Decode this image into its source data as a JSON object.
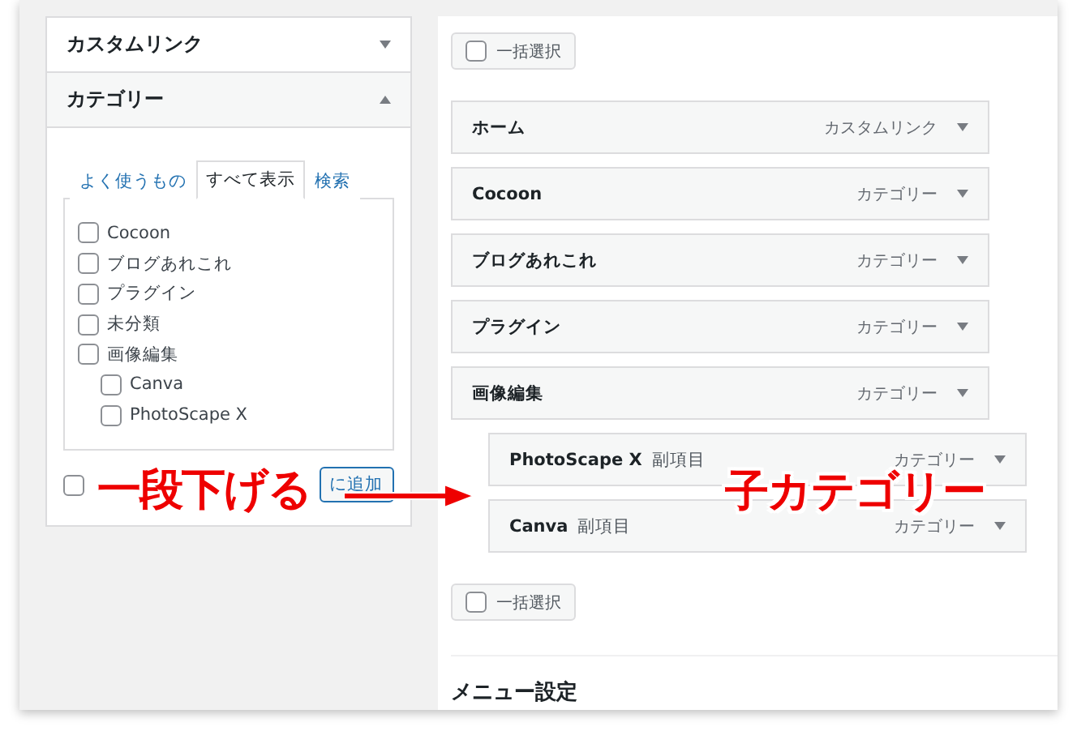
{
  "sidebar": {
    "sections": [
      {
        "title": "カスタムリンク",
        "expanded": false
      },
      {
        "title": "カテゴリー",
        "expanded": true
      }
    ],
    "tabs": [
      {
        "label": "よく使うもの",
        "selected": false
      },
      {
        "label": "すべて表示",
        "selected": true
      },
      {
        "label": "検索",
        "selected": false
      }
    ],
    "categories": [
      {
        "label": "Cocoon",
        "checked": false
      },
      {
        "label": "ブログあれこれ",
        "checked": false
      },
      {
        "label": "プラグイン",
        "checked": false
      },
      {
        "label": "未分類",
        "checked": false
      },
      {
        "label": "画像編集",
        "checked": false,
        "children": [
          {
            "label": "Canva",
            "checked": false
          },
          {
            "label": "PhotoScape X",
            "checked": false
          }
        ]
      }
    ],
    "select_all": {
      "checked": false
    },
    "add_button": "に追加"
  },
  "menu": {
    "bulk_select_top": {
      "label": "一括選択",
      "checked": false
    },
    "items": [
      {
        "title": "ホーム",
        "type": "カスタムリンク"
      },
      {
        "title": "Cocoon",
        "type": "カテゴリー"
      },
      {
        "title": "ブログあれこれ",
        "type": "カテゴリー"
      },
      {
        "title": "プラグイン",
        "type": "カテゴリー"
      },
      {
        "title": "画像編集",
        "type": "カテゴリー",
        "children": [
          {
            "title": "PhotoScape X",
            "sub_label": "副項目",
            "type": "カテゴリー"
          },
          {
            "title": "Canva",
            "sub_label": "副項目",
            "type": "カテゴリー"
          }
        ]
      }
    ],
    "bulk_select_bottom": {
      "label": "一括選択",
      "checked": false
    },
    "settings_heading": "メニュー設定"
  },
  "annotations": [
    {
      "kind": "text",
      "text": "一段下げる"
    },
    {
      "kind": "arrow"
    },
    {
      "kind": "text",
      "text": "子カテゴリー"
    }
  ]
}
